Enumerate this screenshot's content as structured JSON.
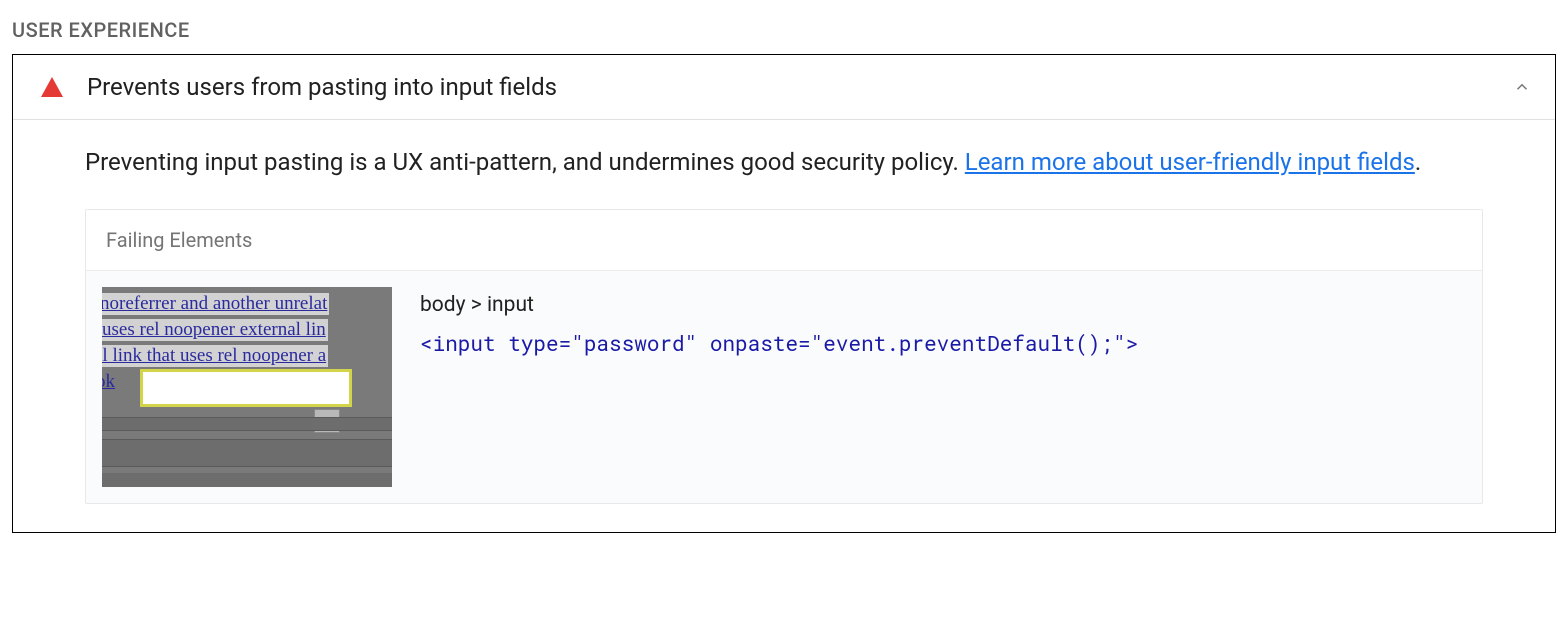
{
  "section": {
    "label": "USER EXPERIENCE"
  },
  "audit": {
    "title": "Prevents users from pasting into input fields",
    "description_prefix": "Preventing input pasting is a UX anti-pattern, and undermines good security policy. ",
    "learn_more_text": "Learn more about user-friendly input fields",
    "description_suffix": ".",
    "failing_elements_label": "Failing Elements",
    "failing": [
      {
        "selector": "body > input",
        "snippet": "<input type=\"password\" onpaste=\"event.preventDefault();\">",
        "thumb_text": {
          "line1": "noreferrer and another unrelat",
          "line2": "t uses rel noopener external lin",
          "line3": "al link that uses rel noopener a",
          "line4": "ok"
        }
      }
    ]
  }
}
